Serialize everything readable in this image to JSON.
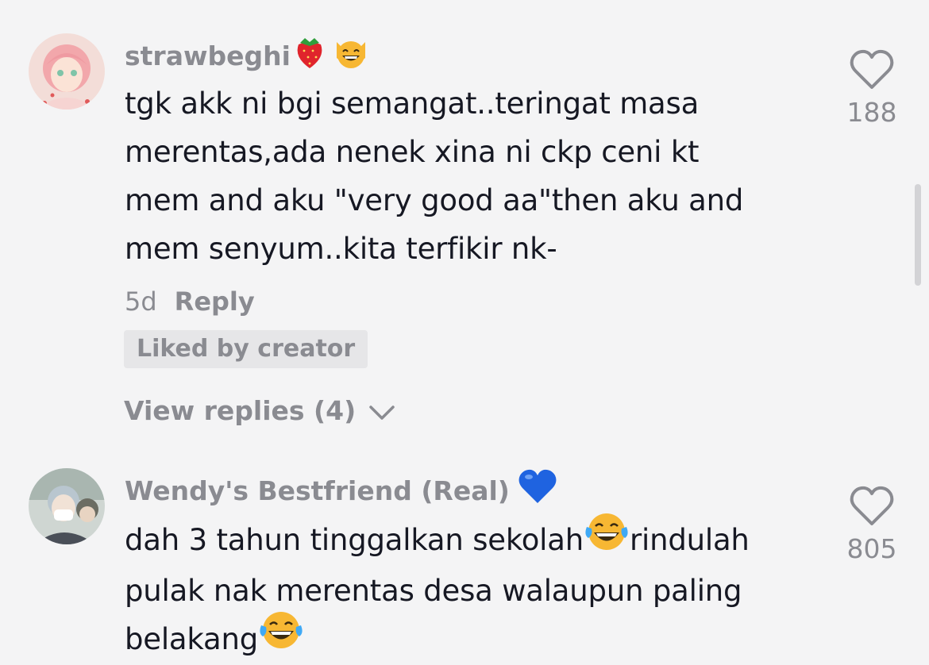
{
  "comments": [
    {
      "username": "strawbeghi",
      "username_emojis": [
        "strawberry-emoji",
        "grinning-cat-emoji"
      ],
      "text_lines": [
        "tgk akk ni bgi semangat..teringat masa",
        "merentas,ada nenek xina ni ckp ceni kt",
        "mem and aku \"very good aa\"then aku and",
        "mem senyum..kita terfikir nk-"
      ],
      "time": "5d",
      "reply_label": "Reply",
      "badge": "Liked by creator",
      "view_replies": "View replies (4)",
      "likes": "188"
    },
    {
      "username": "Wendy's Bestfriend (Real)",
      "username_emojis": [
        "blue-heart-emoji"
      ],
      "text_parts": [
        "dah 3 tahun tinggalkan sekolah",
        "rindulah",
        "pulak nak merentas desa walaupun paling",
        "belakang"
      ],
      "likes": "805"
    }
  ],
  "colors": {
    "background": "#f4f4f5",
    "text": "#161823",
    "muted": "#8a8b91",
    "badge_bg": "#e6e6e8"
  }
}
